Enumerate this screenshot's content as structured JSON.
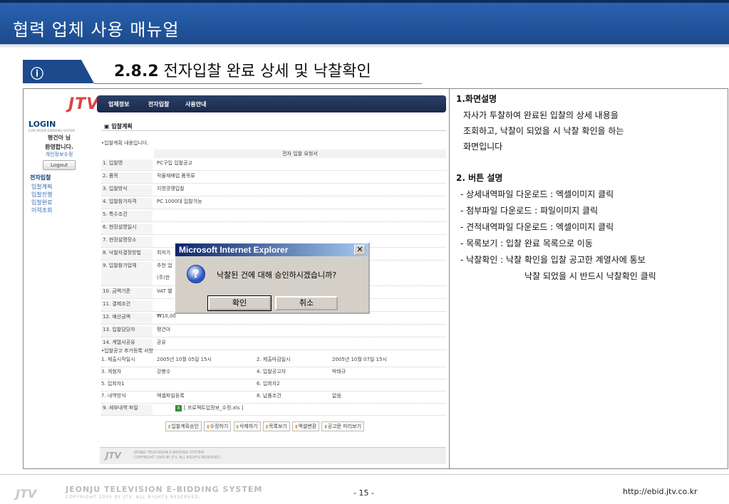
{
  "banner": {
    "title": "협력 업체 사용 매뉴얼"
  },
  "section": {
    "number": "2.8.2",
    "title": "전자입찰 완료 상세 및 낙찰확인"
  },
  "app": {
    "logo": "JTV",
    "nav": [
      "업체정보",
      "전자입찰",
      "사용안내"
    ],
    "login": {
      "title": "LOGIN",
      "subtitle": "E-JIN GROUP E-BIDDING SYSTEM",
      "greeting_name": "평건아 님",
      "greeting": "환영합니다.",
      "edit_link": "개인정보수정",
      "logout": "Logout"
    },
    "sidebar": {
      "head": "전자입찰",
      "items": [
        "입찰계획",
        "입찰진행",
        "입찰완료",
        "이력조회"
      ]
    },
    "page_heading": "입찰계획",
    "intro": "•입찰계획 내용입니다.",
    "grid_header": "전자 입찰 요청서",
    "rows": [
      {
        "k": "1. 입찰명",
        "v": "PC구입 입찰공고"
      },
      {
        "k": "2. 품목",
        "v": "작물재배업 품목류"
      },
      {
        "k": "3. 입찰방식",
        "v": "지명경쟁입찰"
      },
      {
        "k": "4. 입찰참가자격",
        "v": "PC 1000대 입찰가능"
      },
      {
        "k": "5. 특수조건",
        "v": ""
      },
      {
        "k": "6. 현장설명일시",
        "v": ""
      },
      {
        "k": "7. 현장설명장소",
        "v": ""
      },
      {
        "k": "8. 낙찰자결정방법",
        "v": "최저가"
      },
      {
        "k": "9. 입찰참가업체",
        "v": "추천 업",
        "v2": "(주)한"
      },
      {
        "k": "10. 금액기준",
        "v": "VAT 별"
      },
      {
        "k": "11. 결제조건",
        "v": ""
      },
      {
        "k": "12. 예산금액",
        "v": "₩10,00"
      },
      {
        "k": "13. 입찰담당자",
        "v": "평건아"
      },
      {
        "k": "14. 계열사공유",
        "v": "공유"
      }
    ],
    "additional_title": "•입찰공고 추가등록 사항",
    "rows4": [
      {
        "k1": "1. 제출시작일시",
        "v1": "2005년 10월 05일 15시",
        "k2": "2. 제출마감일시",
        "v2": "2005년 10월 07일 15시"
      },
      {
        "k1": "3. 게첨자",
        "v1": "강봉수",
        "k2": "4. 입찰공고자",
        "v2": "박태규"
      },
      {
        "k1": "5. 입회자1",
        "v1": "",
        "k2": "6. 입회자2",
        "v2": ""
      },
      {
        "k1": "7. 내역방식",
        "v1": "엑셀파일등록",
        "k2": "8. 납품조건",
        "v2": "없음"
      }
    ],
    "detail_file_label": "9. 세부내역 파일",
    "detail_file_name": "[ 프로젝트입정보_수정.xls ]",
    "buttons": [
      "입찰계획승인",
      "수정하기",
      "삭제하기",
      "목록보기",
      "엑셀변환",
      "공고문 미리보기"
    ],
    "footer_logo": "JTV",
    "footer_title": "JEONJU TELEVISION E-BIDDING SYSTEM",
    "footer_copy": "COPYRIGHT 2005 BY JTV. ALL RIGHTS RESERVED."
  },
  "dialog": {
    "title": "Microsoft Internet Explorer",
    "close": "✕",
    "icon": "?",
    "message": "낙찰된 건에 대해 승인하시겠습니까?",
    "ok": "확인",
    "cancel": "취소"
  },
  "right": {
    "h1": "1.화면설명",
    "desc": [
      "자사가 투찰하여 완료된 입찰의 상세 내용을",
      "조회하고, 낙찰이 되었을 시 낙찰 확인을 하는",
      "화면입니다"
    ],
    "h2": "2. 버튼 설명",
    "items": [
      "- 상세내역파일 다운로드 : 엑셀이미지 클릭",
      "- 첨부파일 다운로드 : 파일이미지 클릭",
      "- 견적내역파일 다운로드 : 엑셀이미지 클릭",
      "- 목록보기 : 입찰 완료 목록으로 이동",
      "- 낙찰확인 : 낙찰 확인을 입찰 공고한 계열사에 통보"
    ],
    "item_cont": "낙찰 되었을 시 반드시 낙찰확인 클릭"
  },
  "footer": {
    "logo": "JTV",
    "brand": "JEONJU TELEVISION E-BIDDING SYSTEM",
    "copy": "COPYRIGHT 2005 BY JTV. ALL RIGHTS RESERVED.",
    "page": "- 15 -",
    "url": "http://ebid.jtv.co.kr"
  }
}
